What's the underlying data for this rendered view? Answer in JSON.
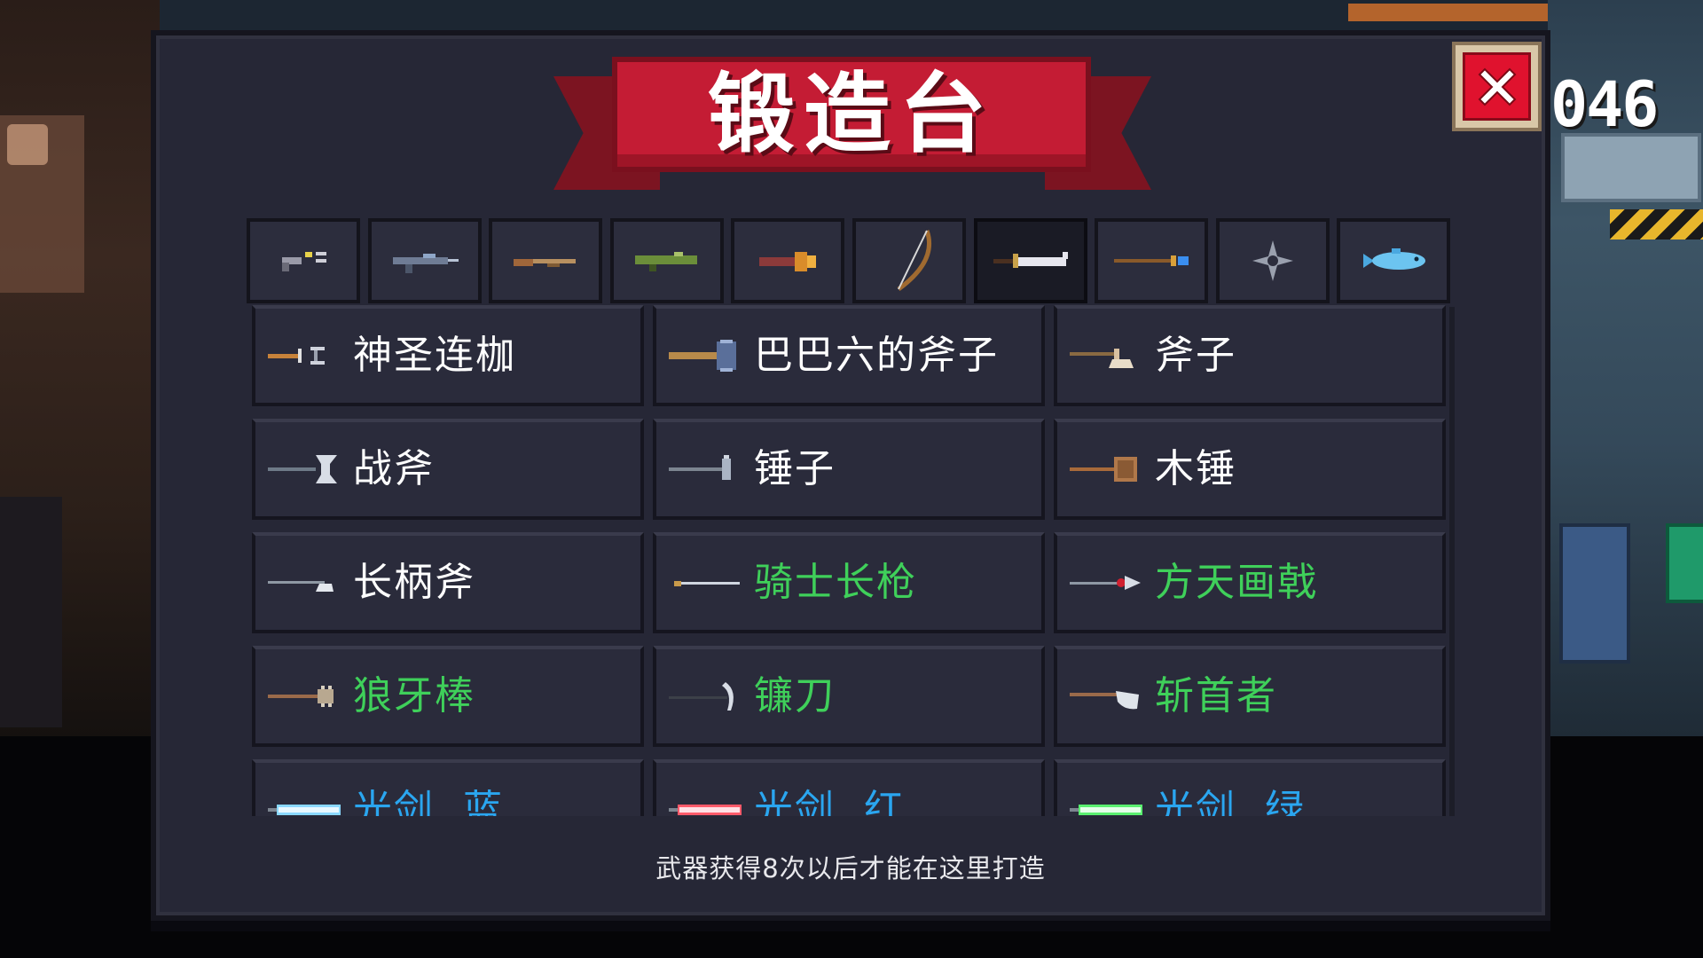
{
  "title": "锻造台",
  "score_partial": "046",
  "footer_hint": "武器获得8次以后才能在这里打造",
  "colors": {
    "panel": "#262736",
    "banner": "#c41c34",
    "white_rarity": "#ffffff",
    "green_rarity": "#3fd05a",
    "blue_rarity": "#2aa6f0"
  },
  "tabs": [
    {
      "name": "pistol",
      "icon": "pistol-icon"
    },
    {
      "name": "rifle",
      "icon": "assault-rifle-icon"
    },
    {
      "name": "shotgun",
      "icon": "shotgun-icon"
    },
    {
      "name": "launcher",
      "icon": "rocket-launcher-icon"
    },
    {
      "name": "flamethrower",
      "icon": "flamethrower-icon"
    },
    {
      "name": "bow",
      "icon": "bow-icon"
    },
    {
      "name": "blade",
      "icon": "sword-icon",
      "active": true
    },
    {
      "name": "staff",
      "icon": "staff-icon"
    },
    {
      "name": "shuriken",
      "icon": "shuriken-icon"
    },
    {
      "name": "fish",
      "icon": "fish-icon"
    }
  ],
  "weapons": [
    {
      "label": "神圣连枷",
      "rarity": "white",
      "icon": "holy-flail-icon"
    },
    {
      "label": "巴巴六的斧子",
      "rarity": "white",
      "icon": "hammer-axe-icon"
    },
    {
      "label": "斧子",
      "rarity": "white",
      "icon": "axe-icon"
    },
    {
      "label": "战斧",
      "rarity": "white",
      "icon": "battle-axe-icon"
    },
    {
      "label": "锤子",
      "rarity": "white",
      "icon": "hammer-icon"
    },
    {
      "label": "木锤",
      "rarity": "white",
      "icon": "wooden-mallet-icon"
    },
    {
      "label": "长柄斧",
      "rarity": "white",
      "icon": "long-axe-icon"
    },
    {
      "label": "骑士长枪",
      "rarity": "green",
      "icon": "lance-icon"
    },
    {
      "label": "方天画戟",
      "rarity": "green",
      "icon": "halberd-icon"
    },
    {
      "label": "狼牙棒",
      "rarity": "green",
      "icon": "mace-icon"
    },
    {
      "label": "镰刀",
      "rarity": "green",
      "icon": "scythe-icon"
    },
    {
      "label": "斩首者",
      "rarity": "green",
      "icon": "executioner-icon"
    },
    {
      "label": "光剑  蓝",
      "rarity": "blue",
      "icon": "lightsaber-blue-icon"
    },
    {
      "label": "光剑  红",
      "rarity": "blue",
      "icon": "lightsaber-red-icon"
    },
    {
      "label": "光剑  绿",
      "rarity": "blue",
      "icon": "lightsaber-green-icon"
    }
  ]
}
